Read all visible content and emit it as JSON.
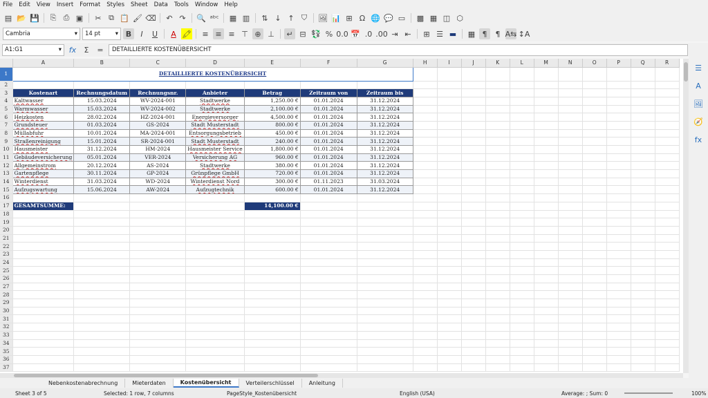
{
  "menu": [
    "File",
    "Edit",
    "View",
    "Insert",
    "Format",
    "Styles",
    "Sheet",
    "Data",
    "Tools",
    "Window",
    "Help"
  ],
  "toolbar": {
    "font_name": "Cambria",
    "font_size": "14 pt"
  },
  "formula": {
    "name_box": "A1:G1",
    "content": "DETAILLIERTE KOSTENÜBERSICHT"
  },
  "columns": [
    "A",
    "B",
    "C",
    "D",
    "E",
    "F",
    "G",
    "H",
    "I",
    "J",
    "K",
    "L",
    "M",
    "N",
    "O",
    "P",
    "Q",
    "R"
  ],
  "sheet": {
    "title": "DETAILLIERTE KOSTENÜBERSICHT",
    "headers": [
      "Kostenart",
      "Rechnungsdatum",
      "Rechnungsnr.",
      "Anbieter",
      "Betrag",
      "Zeitraum von",
      "Zeitraum bis"
    ],
    "rows": [
      [
        "Kaltwasser",
        "15.03.2024",
        "WV-2024-001",
        "Stadtwerke",
        "1,250.00 €",
        "01.01.2024",
        "31.12.2024"
      ],
      [
        "Warmwasser",
        "15.03.2024",
        "WV-2024-002",
        "Stadtwerke",
        "2,100.00 €",
        "01.01.2024",
        "31.12.2024"
      ],
      [
        "Heizkosten",
        "28.02.2024",
        "HZ-2024-001",
        "Energieversorger",
        "4,500.00 €",
        "01.01.2024",
        "31.12.2024"
      ],
      [
        "Grundsteuer",
        "01.03.2024",
        "GS-2024",
        "Stadt Musterstadt",
        "800.00 €",
        "01.01.2024",
        "31.12.2024"
      ],
      [
        "Müllabfuhr",
        "10.01.2024",
        "MA-2024-001",
        "Entsorgungsbetrieb",
        "450.00 €",
        "01.01.2024",
        "31.12.2024"
      ],
      [
        "Straßenreinigung",
        "15.01.2024",
        "SR-2024-001",
        "Stadt Musterstadt",
        "240.00 €",
        "01.01.2024",
        "31.12.2024"
      ],
      [
        "Hausmeister",
        "31.12.2024",
        "HM-2024",
        "Hausmeister Service",
        "1,800.00 €",
        "01.01.2024",
        "31.12.2024"
      ],
      [
        "Gebäudeversicherung",
        "05.01.2024",
        "VER-2024",
        "Versicherung AG",
        "960.00 €",
        "01.01.2024",
        "31.12.2024"
      ],
      [
        "Allgemeinstrom",
        "20.12.2024",
        "AS-2024",
        "Stadtwerke",
        "380.00 €",
        "01.01.2024",
        "31.12.2024"
      ],
      [
        "Gartenpflege",
        "30.11.2024",
        "GP-2024",
        "Grünpflege GmbH",
        "720.00 €",
        "01.01.2024",
        "31.12.2024"
      ],
      [
        "Winterdienst",
        "31.03.2024",
        "WD-2024",
        "Winterdienst Nord",
        "300.00 €",
        "01.11.2023",
        "31.03.2024"
      ],
      [
        "Aufzugswartung",
        "15.06.2024",
        "AW-2024",
        "Aufzugtechnik",
        "600.00 €",
        "01.01.2024",
        "31.12.2024"
      ]
    ],
    "total_label": "GESAMTSUMME:",
    "total_value": "14,100.00 €"
  },
  "tabs": [
    "Nebenkostenabrechnung",
    "Mieterdaten",
    "Kostenübersicht",
    "Verteilerschlüssel",
    "Anleitung"
  ],
  "active_tab": "Kostenübersicht",
  "status": {
    "sheet": "Sheet 3 of 5",
    "selection": "Selected: 1 row, 7 columns",
    "page_style": "PageStyle_Kostenübersicht",
    "language": "English (USA)",
    "summary": "Average: ; Sum: 0",
    "zoom": "100%"
  },
  "colors": {
    "header_bg": "#1f3b7a",
    "selection": "#3c78c8"
  }
}
